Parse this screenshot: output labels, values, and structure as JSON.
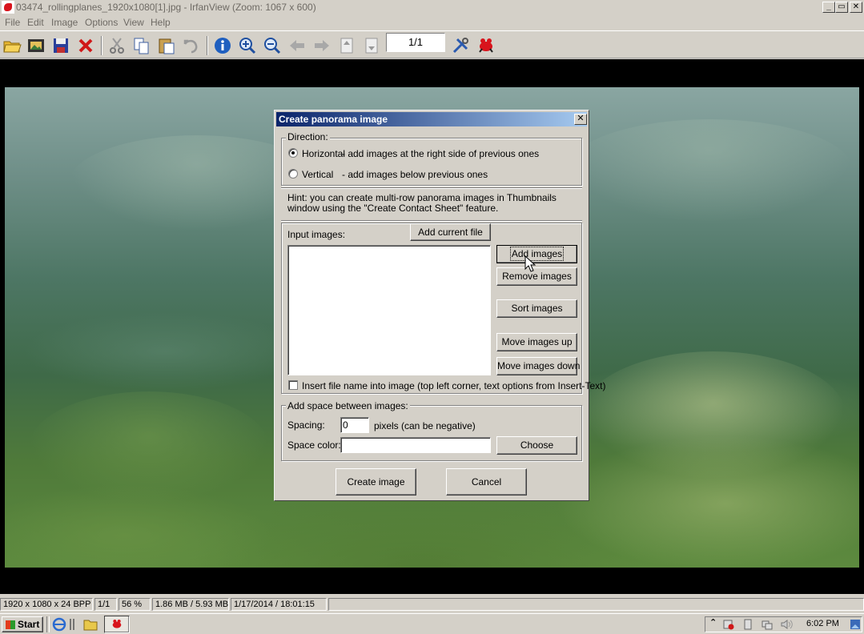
{
  "window": {
    "title": "03474_rollingplanes_1920x1080[1].jpg - IrfanView (Zoom: 1067 x 600)",
    "caption_buttons": [
      "_",
      "▭",
      "✕"
    ]
  },
  "menu": [
    "File",
    "Edit",
    "Image",
    "Options",
    "View",
    "Help"
  ],
  "toolbar": {
    "page_indicator": "1/1",
    "icons": [
      "open-folder-icon",
      "slideshow-icon",
      "save-icon",
      "delete-icon",
      "cut-icon",
      "copy-icon",
      "paste-icon",
      "undo-icon",
      "info-icon",
      "zoom-in-icon",
      "zoom-out-icon",
      "previous-icon",
      "next-icon",
      "first-page-icon",
      "last-page-icon",
      "settings-icon",
      "irfanview-logo-icon"
    ]
  },
  "dialog": {
    "title": "Create panorama image",
    "close_label": "✕",
    "direction": {
      "label": "Direction:",
      "horizontal_label": "Horizontal",
      "horizontal_desc": "- add images at the right side of previous ones",
      "vertical_label": "Vertical",
      "vertical_desc": "- add images below previous ones",
      "selected": "horizontal"
    },
    "hint": "Hint: you can create multi-row panorama images in Thumbnails window using the \"Create Contact Sheet\" feature.",
    "input_images_label": "Input images:",
    "add_current_file": "Add current file",
    "add_images": "Add images",
    "remove_images": "Remove images",
    "sort_images": "Sort images",
    "move_up": "Move images up",
    "move_down": "Move images down",
    "insert_filename_label": "Insert file name into image (top left corner, text options from Insert-Text)",
    "insert_filename_checked": false,
    "space_group_label": "Add space between images:",
    "spacing_label": "Spacing:",
    "spacing_value": "0",
    "spacing_unit": "pixels (can be negative)",
    "space_color_label": "Space color:",
    "choose": "Choose",
    "create_image": "Create image",
    "cancel": "Cancel"
  },
  "status": {
    "dimensions": "1920 x 1080 x 24 BPP",
    "page": "1/1",
    "zoom": "56 %",
    "size": "1.86 MB / 5.93 MB",
    "date": "1/17/2014 / 18:01:15"
  },
  "taskbar": {
    "start": "Start",
    "clock": "6:02 PM"
  }
}
